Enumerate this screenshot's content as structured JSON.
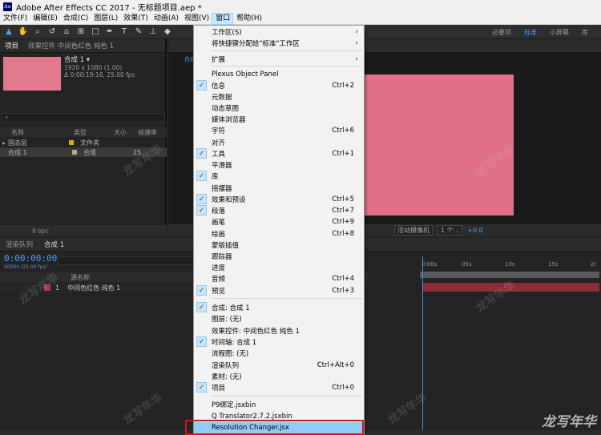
{
  "window": {
    "title": "Adobe After Effects CC 2017 - 无标题项目.aep *",
    "app_icon": "Ae"
  },
  "menubar": [
    "文件(F)",
    "编辑(E)",
    "合成(C)",
    "图层(L)",
    "效果(T)",
    "动画(A)",
    "视图(V)",
    "窗口",
    "帮助(H)"
  ],
  "workspaces": [
    "必要项",
    "标准",
    "小屏幕",
    "库"
  ],
  "project": {
    "tab": "项目",
    "tab2": "效果控件 中间色红色 纯色 1",
    "comp_name": "合成 1 ▾",
    "comp_size": "1920 x 1080 (1.00)",
    "comp_dur": "Δ 0:00:19:16, 25.00 fps",
    "search_icon": "⌕",
    "col_name": "名称",
    "col_type": "类型",
    "col_size": "大小",
    "col_rate": "帧速率",
    "rows": [
      {
        "name": "固态层",
        "type": "文件夹",
        "rate": ""
      },
      {
        "name": "合成 1",
        "type": "合成",
        "rate": "25"
      }
    ],
    "bpc": "8 bpc"
  },
  "viewer": {
    "tab": "合成",
    "view_select": "活动摄像机",
    "views_select": "1 个...",
    "exposure": "+0.0"
  },
  "timeline": {
    "tab_render": "渲染队列",
    "tab_comp": "合成 1",
    "timecode": "0:00:00:00",
    "fps": "00000 (25.00 fps)",
    "col_name": "源名称",
    "layer": {
      "num": "1",
      "name": "中间色红色 纯色 1"
    },
    "ruler": [
      "0:00s",
      "05s",
      "10s",
      "15s",
      "2("
    ]
  },
  "window_menu": {
    "items": [
      {
        "label": "工作区(S)",
        "shortcut": "",
        "checked": false,
        "submenu": true
      },
      {
        "label": "将快捷键分配给\"标准\"工作区",
        "shortcut": "",
        "checked": false,
        "submenu": true
      },
      {
        "label": "扩展",
        "shortcut": "",
        "checked": false,
        "submenu": true
      },
      {
        "label": "Plexus Object Panel",
        "shortcut": "",
        "checked": false,
        "submenu": false
      },
      {
        "label": "信息",
        "shortcut": "Ctrl+2",
        "checked": true,
        "submenu": false
      },
      {
        "label": "元数据",
        "shortcut": "",
        "checked": false,
        "submenu": false
      },
      {
        "label": "动态草图",
        "shortcut": "",
        "checked": false,
        "submenu": false
      },
      {
        "label": "媒体浏览器",
        "shortcut": "",
        "checked": false,
        "submenu": false
      },
      {
        "label": "字符",
        "shortcut": "Ctrl+6",
        "checked": false,
        "submenu": false
      },
      {
        "label": "对齐",
        "shortcut": "",
        "checked": false,
        "submenu": false
      },
      {
        "label": "工具",
        "shortcut": "Ctrl+1",
        "checked": true,
        "submenu": false
      },
      {
        "label": "平滑器",
        "shortcut": "",
        "checked": false,
        "submenu": false
      },
      {
        "label": "库",
        "shortcut": "",
        "checked": true,
        "submenu": false
      },
      {
        "label": "摇摆器",
        "shortcut": "",
        "checked": false,
        "submenu": false
      },
      {
        "label": "效果和预设",
        "shortcut": "Ctrl+5",
        "checked": true,
        "submenu": false
      },
      {
        "label": "段落",
        "shortcut": "Ctrl+7",
        "checked": true,
        "submenu": false
      },
      {
        "label": "画笔",
        "shortcut": "Ctrl+9",
        "checked": false,
        "submenu": false
      },
      {
        "label": "绘画",
        "shortcut": "Ctrl+8",
        "checked": false,
        "submenu": false
      },
      {
        "label": "蒙版插值",
        "shortcut": "",
        "checked": false,
        "submenu": false
      },
      {
        "label": "跟踪器",
        "shortcut": "",
        "checked": false,
        "submenu": false
      },
      {
        "label": "进度",
        "shortcut": "",
        "checked": false,
        "submenu": false
      },
      {
        "label": "音频",
        "shortcut": "Ctrl+4",
        "checked": false,
        "submenu": false
      },
      {
        "label": "预览",
        "shortcut": "Ctrl+3",
        "checked": true,
        "submenu": false
      },
      {
        "label": "合成: 合成 1",
        "shortcut": "",
        "checked": true,
        "submenu": false
      },
      {
        "label": "图层: (无)",
        "shortcut": "",
        "checked": false,
        "submenu": false
      },
      {
        "label": "效果控件: 中间色红色 纯色 1",
        "shortcut": "",
        "checked": false,
        "submenu": false
      },
      {
        "label": "时间轴: 合成 1",
        "shortcut": "",
        "checked": true,
        "submenu": false
      },
      {
        "label": "流程图: (无)",
        "shortcut": "",
        "checked": false,
        "submenu": false
      },
      {
        "label": "渲染队列",
        "shortcut": "Ctrl+Alt+0",
        "checked": false,
        "submenu": false
      },
      {
        "label": "素材: (无)",
        "shortcut": "",
        "checked": false,
        "submenu": false
      },
      {
        "label": "项目",
        "shortcut": "Ctrl+0",
        "checked": true,
        "submenu": false
      },
      {
        "label": "P9绑定.jsxbin",
        "shortcut": "",
        "checked": false,
        "submenu": false
      },
      {
        "label": "Q Translator2.7.2.jsxbin",
        "shortcut": "",
        "checked": false,
        "submenu": false
      },
      {
        "label": "Resolution Changer.jsx",
        "shortcut": "",
        "checked": false,
        "submenu": false
      }
    ],
    "check_glyph": "✓",
    "arrow_glyph": "›"
  },
  "watermark": "龙写年华",
  "colors": {
    "accent": "#4d9eff",
    "comp_bg": "#e07088",
    "highlight": "#91c9f7",
    "red_box": "#d8141a"
  }
}
